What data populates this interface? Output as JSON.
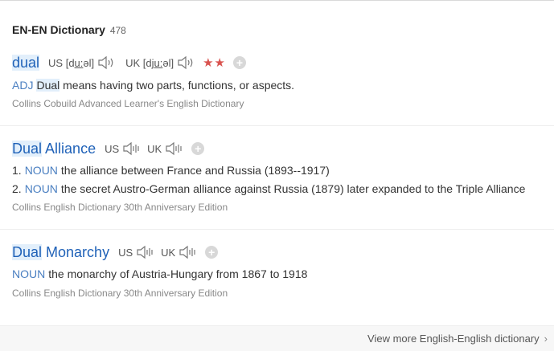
{
  "header": {
    "title": "EN-EN Dictionary",
    "count": "478"
  },
  "entries": [
    {
      "word_hl": "dual",
      "word_rest": "",
      "us_label": "US [d",
      "us_ul": "u:",
      "us_end": "əl]",
      "uk_label": "UK [dj",
      "uk_ul": "u:",
      "uk_end": "əl]",
      "stars": "★★",
      "def_pos": "ADJ",
      "def_hl": "Dual",
      "def_text": " means having two parts, functions, or aspects.",
      "source": "Collins Cobuild Advanced Learner's English Dictionary"
    },
    {
      "word_hl": "Dual",
      "word_rest": " Alliance",
      "us": "US",
      "uk": "UK",
      "senses": [
        {
          "num": "1.",
          "pos": "NOUN",
          "text": "the alliance between France and Russia (1893--1917)"
        },
        {
          "num": "2.",
          "pos": "NOUN",
          "text": "the secret Austro-German alliance against Russia (1879) later expanded to the Triple Alliance"
        }
      ],
      "source": "Collins English Dictionary 30th Anniversary Edition"
    },
    {
      "word_hl": "Dual",
      "word_rest": " Monarchy",
      "us": "US",
      "uk": "UK",
      "def_pos": "NOUN",
      "def_text": "the monarchy of Austria-Hungary from 1867 to 1918",
      "source": "Collins English Dictionary 30th Anniversary Edition"
    }
  ],
  "footer": {
    "more_label": "View more English-English dictionary",
    "chevron": "›"
  },
  "icons": {
    "speaker": "speaker-icon",
    "add": "plus-icon"
  },
  "colors": {
    "word": "#2062b8",
    "highlight": "#e2effb",
    "pos": "#4a7fc1",
    "stars": "#d9534f"
  }
}
